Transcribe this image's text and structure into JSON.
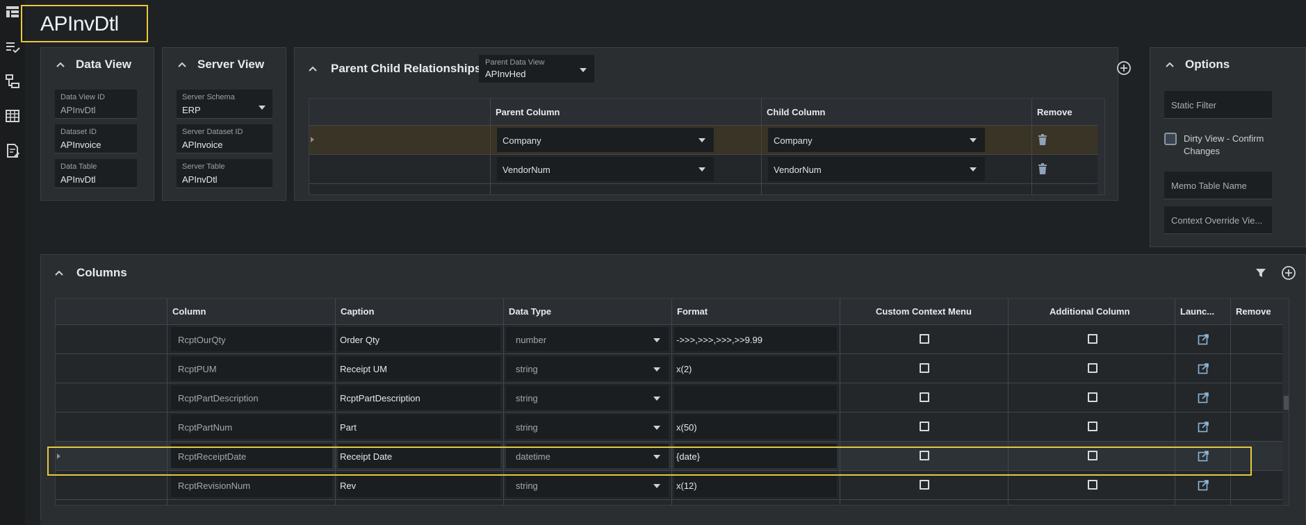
{
  "page_title": "APInvDtl",
  "colors": {
    "accent": "#e8c93a",
    "bg": "#1f2224",
    "panel": "#2a2e31",
    "selected_row": "#3a3426"
  },
  "rail_icons": [
    "grid-layout-icon",
    "list-check-icon",
    "tree-structure-icon",
    "table-icon",
    "edit-document-icon"
  ],
  "data_view": {
    "title": "Data View",
    "fields": [
      {
        "label": "Data View ID",
        "value": "APInvDtl",
        "readonly": true
      },
      {
        "label": "Dataset ID",
        "value": "APInvoice",
        "readonly": false
      },
      {
        "label": "Data Table",
        "value": "APInvDtl",
        "readonly": false
      }
    ]
  },
  "server_view": {
    "title": "Server View",
    "fields": [
      {
        "label": "Server Schema",
        "value": "ERP"
      },
      {
        "label": "Server Dataset ID",
        "value": "APInvoice"
      },
      {
        "label": "Server Table",
        "value": "APInvDtl"
      }
    ]
  },
  "parent_child": {
    "title": "Parent Child Relationships",
    "parent_data_view_label": "Parent Data View",
    "parent_data_view_value": "APInvHed",
    "headers": [
      "",
      "Parent Column",
      "Child Column",
      "Remove"
    ],
    "rows": [
      {
        "parent": "Company",
        "child": "Company"
      },
      {
        "parent": "VendorNum",
        "child": "VendorNum"
      }
    ]
  },
  "options": {
    "title": "Options",
    "static_filter": "Static Filter",
    "dirty_view_label": "Dirty View - Confirm Changes",
    "memo_table": "Memo Table Name",
    "context_override": "Context Override Vie..."
  },
  "columns": {
    "title": "Columns",
    "headers": [
      "",
      "Column",
      "Caption",
      "Data Type",
      "Format",
      "Custom Context Menu",
      "Additional Column",
      "Launc...",
      "Remove"
    ],
    "rows": [
      {
        "column": "RcptOurQty",
        "caption": "Order Qty",
        "data_type": "number",
        "format": "->>>,>>>,>>>,>>9.99"
      },
      {
        "column": "RcptPUM",
        "caption": "Receipt UM",
        "data_type": "string",
        "format": "x(2)"
      },
      {
        "column": "RcptPartDescription",
        "caption": "RcptPartDescription",
        "data_type": "string",
        "format": ""
      },
      {
        "column": "RcptPartNum",
        "caption": "Part",
        "data_type": "string",
        "format": "x(50)"
      },
      {
        "column": "RcptReceiptDate",
        "caption": "Receipt Date",
        "data_type": "datetime",
        "format": "{date}"
      },
      {
        "column": "RcptRevisionNum",
        "caption": "Rev",
        "data_type": "string",
        "format": "x(12)"
      }
    ]
  }
}
